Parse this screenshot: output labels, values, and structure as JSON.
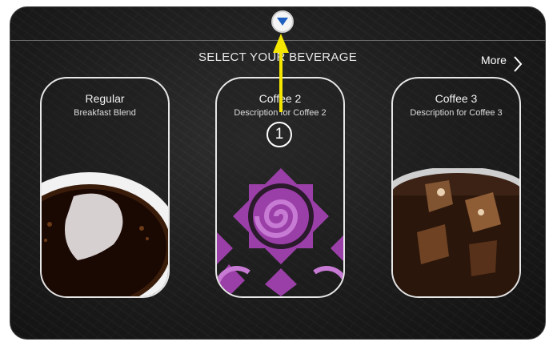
{
  "header": {
    "title": "SELECT YOUR BEVERAGE",
    "more_label": "More"
  },
  "home_button_icon": "home-pointer-icon",
  "cards": [
    {
      "name": "Regular",
      "description": "Breakfast Blend",
      "image": "coffee-cup-image"
    },
    {
      "name": "Coffee 2",
      "description": "Description for Coffee 2",
      "image": "purple-swirl-pattern-image"
    },
    {
      "name": "Coffee 3",
      "description": "Description for Coffee 3",
      "image": "iced-coffee-image"
    }
  ],
  "annotation": {
    "step_number": "1",
    "arrow_color": "#f5e600"
  },
  "colors": {
    "accent_purple": "#9b3fa8",
    "home_triangle": "#1f5fbf",
    "background": "#1c1c1c"
  }
}
